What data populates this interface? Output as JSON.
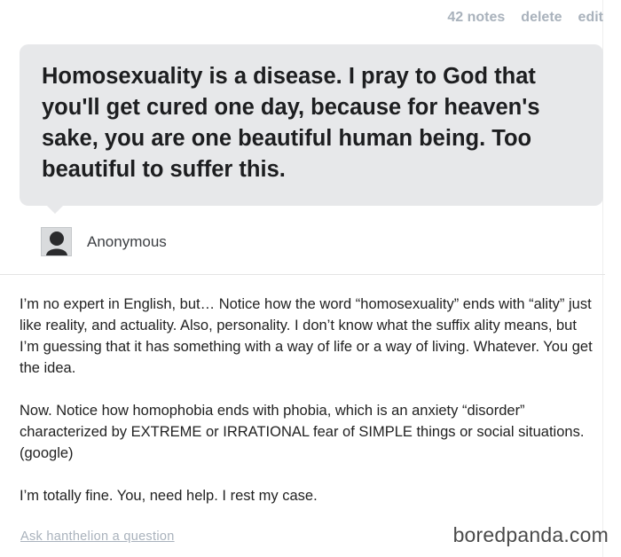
{
  "post_actions": {
    "notes": "42 notes",
    "delete": "delete",
    "edit": "edit"
  },
  "question": {
    "text": "Homosexuality is a disease. I pray to God that you'll get cured one day, because for heaven's sake, you are one beautiful human being. Too beautiful to suffer this.",
    "asker_name": "Anonymous",
    "asker_avatar_icon": "anonymous-silhouette-icon"
  },
  "answer": {
    "paragraphs": [
      "I’m no expert in English, but… Notice how the word “homosexuality” ends with “ality” just like reality, and actuality. Also, personality. I don’t know what the suffix ality means, but I’m guessing that it has something with a way of life or a way of living. Whatever. You get the idea.",
      "Now. Notice how homophobia ends with phobia, which is an anxiety “disorder” characterized by EXTREME or IRRATIONAL fear of SIMPLE things or social situations. (google)",
      "I’m totally fine. You, need help. I rest my case."
    ]
  },
  "footer": {
    "ask_link": "Ask hanthelion a question",
    "watermark": "boredpanda.com"
  },
  "colors": {
    "bubble_bg": "#e7e8ea",
    "muted_link": "#a9b2bc"
  }
}
